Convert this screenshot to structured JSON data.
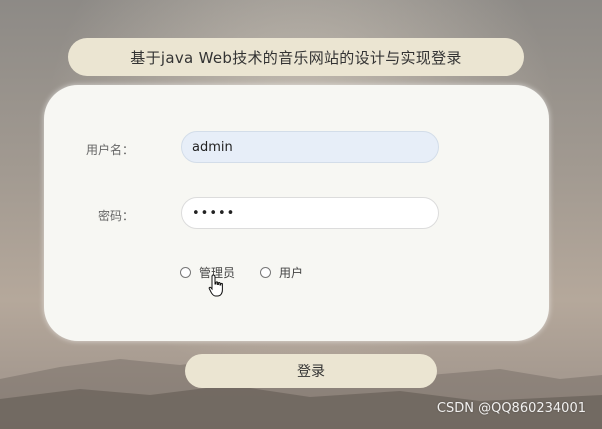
{
  "title": "基于java Web技术的音乐网站的设计与实现登录",
  "form": {
    "username_label": "用户名：",
    "username_value": "admin",
    "password_label": "密码：",
    "password_mask": "•••••",
    "role_options": [
      "管理员",
      "用户"
    ]
  },
  "login_button": "登录",
  "watermark": "CSDN @QQ860234001",
  "icons": {
    "cursor": "hand-pointer-icon"
  },
  "colors": {
    "title_bg": "#ebe5d2",
    "card_bg": "#f7f7f3",
    "username_field_bg": "#e7eef8"
  }
}
